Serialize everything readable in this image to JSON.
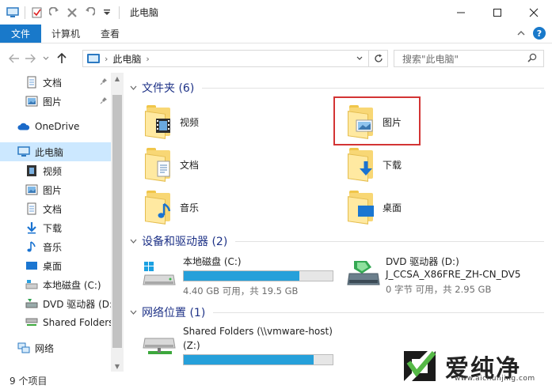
{
  "window": {
    "title": "此电脑"
  },
  "ribbon": {
    "tabs": [
      "文件",
      "计算机",
      "查看"
    ]
  },
  "address": {
    "crumb": "此电脑",
    "search_placeholder": "搜索\"此电脑\""
  },
  "nav": {
    "items": [
      {
        "label": "文档",
        "icon": "documents-icon",
        "pinned": true
      },
      {
        "label": "图片",
        "icon": "pictures-icon",
        "pinned": true
      },
      {
        "label": "OneDrive",
        "icon": "onedrive-icon"
      },
      {
        "label": "此电脑",
        "icon": "this-pc-icon",
        "selected": true
      },
      {
        "label": "视频",
        "icon": "videos-icon"
      },
      {
        "label": "图片",
        "icon": "pictures-icon"
      },
      {
        "label": "文档",
        "icon": "documents-icon"
      },
      {
        "label": "下载",
        "icon": "downloads-icon"
      },
      {
        "label": "音乐",
        "icon": "music-icon"
      },
      {
        "label": "桌面",
        "icon": "desktop-icon"
      },
      {
        "label": "本地磁盘 (C:)",
        "icon": "local-disk-icon"
      },
      {
        "label": "DVD 驱动器 (D:",
        "icon": "dvd-drive-icon"
      },
      {
        "label": "Shared Folders",
        "icon": "network-drive-icon"
      },
      {
        "label": "网络",
        "icon": "network-icon"
      }
    ]
  },
  "content": {
    "folders_header": "文件夹 (6)",
    "folders": [
      "视频",
      "图片",
      "文档",
      "下载",
      "音乐",
      "桌面"
    ],
    "devices_header": "设备和驱动器 (2)",
    "drives": [
      {
        "name": "本地磁盘 (C:)",
        "status": "4.40 GB 可用，共 19.5 GB",
        "used_fraction": 0.774
      },
      {
        "name": "DVD 驱动器 (D:)",
        "subname": "J_CCSA_X86FRE_ZH-CN_DV5",
        "status": "0 字节 可用，共 2.95 GB"
      }
    ],
    "network_header": "网络位置 (1)",
    "network": [
      {
        "name": "Shared Folders (\\\\vmware-host)",
        "subname": "(Z:)",
        "used_fraction": 0.87
      }
    ]
  },
  "status": {
    "count": "9 个项目"
  },
  "watermark": {
    "brand": "爱纯净",
    "url": "www.aichunjing.com"
  },
  "colors": {
    "accent": "#1979ca",
    "selection": "#cce8ff",
    "group_title": "#1e3287",
    "bar_fill": "#26a0da",
    "highlight": "#d33434"
  }
}
